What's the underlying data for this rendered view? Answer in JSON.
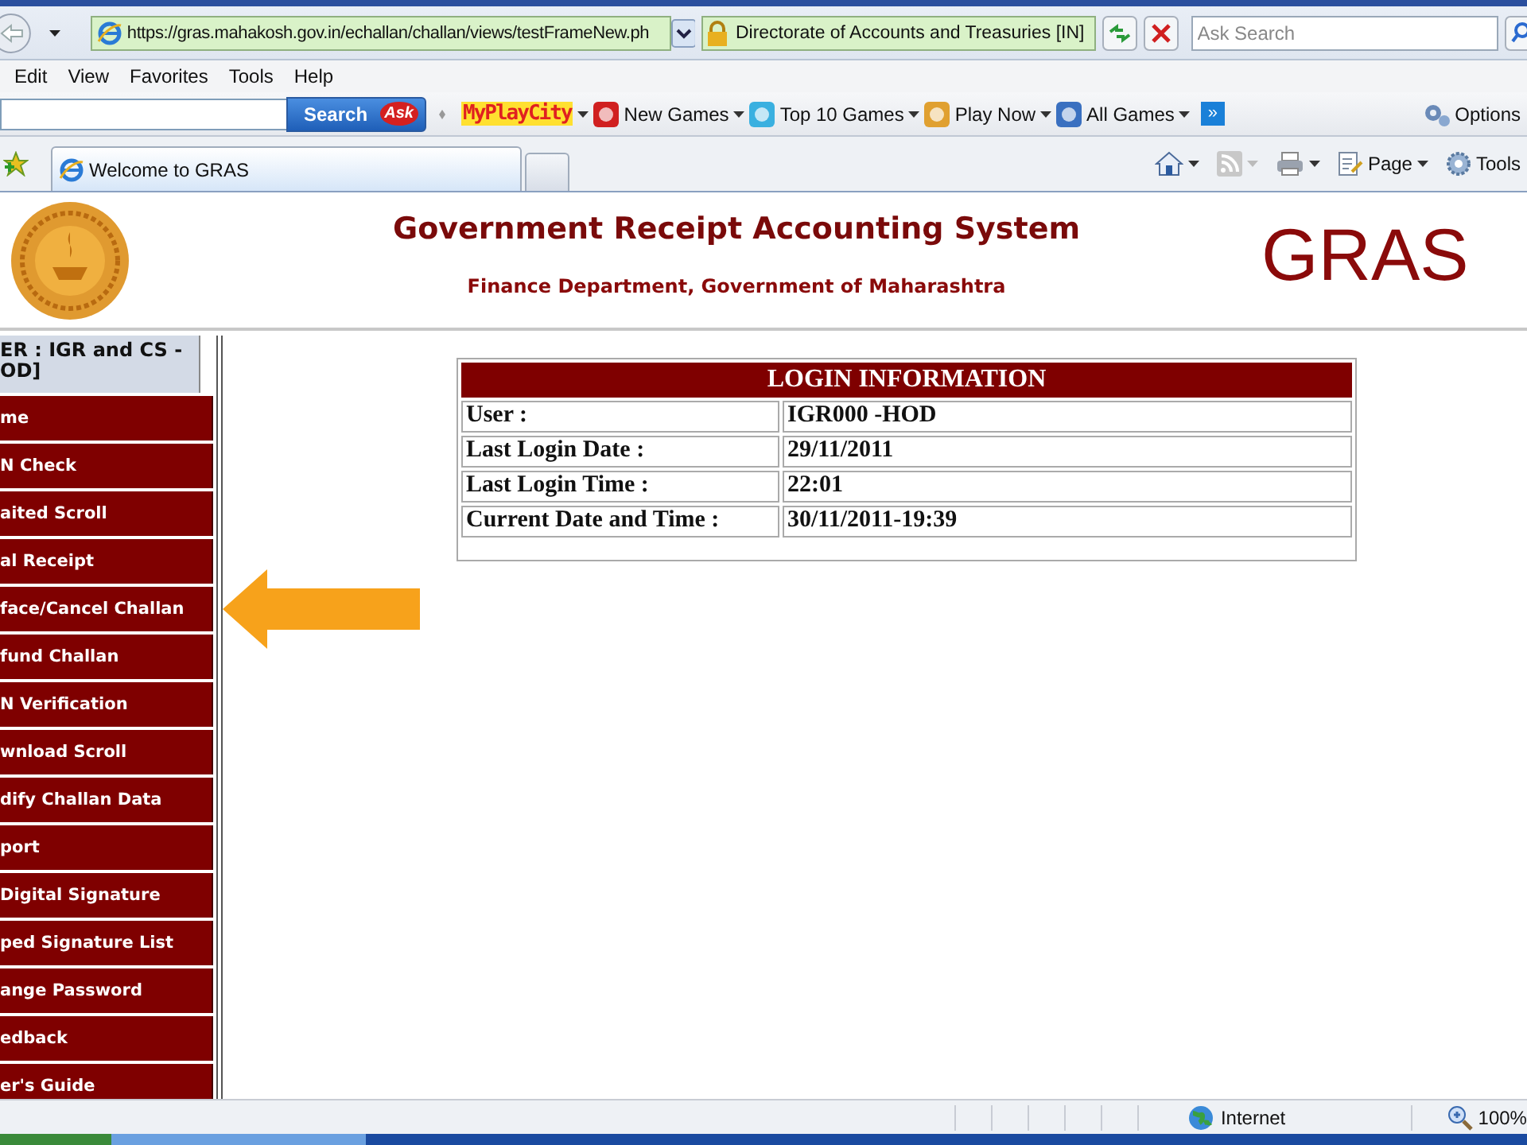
{
  "browser": {
    "address": "https://gras.mahakosh.gov.in/echallan/challan/views/testFrameNew.ph",
    "site_identity": "Directorate of Accounts and Treasuries [IN]",
    "search_placeholder": "Ask Search",
    "menu": [
      "Edit",
      "View",
      "Favorites",
      "Tools",
      "Help"
    ],
    "toolbar": {
      "search_button": "Search",
      "search_logo": "Ask",
      "brand": "MyPlayCity",
      "links": [
        "New Games",
        "Top 10 Games",
        "Play Now",
        "All Games"
      ],
      "more": "»",
      "options": "Options"
    },
    "tabs": [
      {
        "title": "Welcome to GRAS",
        "selected": true
      }
    ],
    "command_bar": {
      "page": "Page",
      "tools": "Tools"
    }
  },
  "page": {
    "header": {
      "title": "Government Receipt Accounting System",
      "subtitle": "Finance Department, Government of Maharashtra",
      "brand": "GRAS"
    },
    "sidebar": {
      "user_label": "ER : IGR and CS - OD]",
      "items": [
        {
          "label": "me"
        },
        {
          "label": "N Check"
        },
        {
          "label": "aited Scroll"
        },
        {
          "label": "al Receipt"
        },
        {
          "label": "face/Cancel Challan"
        },
        {
          "label": "fund Challan"
        },
        {
          "label": "N Verification"
        },
        {
          "label": "wnload Scroll"
        },
        {
          "label": "dify Challan Data"
        },
        {
          "label": "port"
        },
        {
          "label": "Digital Signature"
        },
        {
          "label": "ped Signature List"
        },
        {
          "label": "ange Password"
        },
        {
          "label": "edback"
        },
        {
          "label": "er's Guide"
        }
      ]
    },
    "login_info": {
      "title": "LOGIN INFORMATION",
      "rows": [
        {
          "label": "User :",
          "value": "IGR000 -HOD"
        },
        {
          "label": "Last Login Date :",
          "value": "29/11/2011"
        },
        {
          "label": "Last Login Time :",
          "value": "22:01"
        },
        {
          "label": "Current Date and Time :",
          "value": "30/11/2011-19:39"
        }
      ]
    }
  },
  "status_bar": {
    "zone": "Internet",
    "zoom": "100%"
  }
}
